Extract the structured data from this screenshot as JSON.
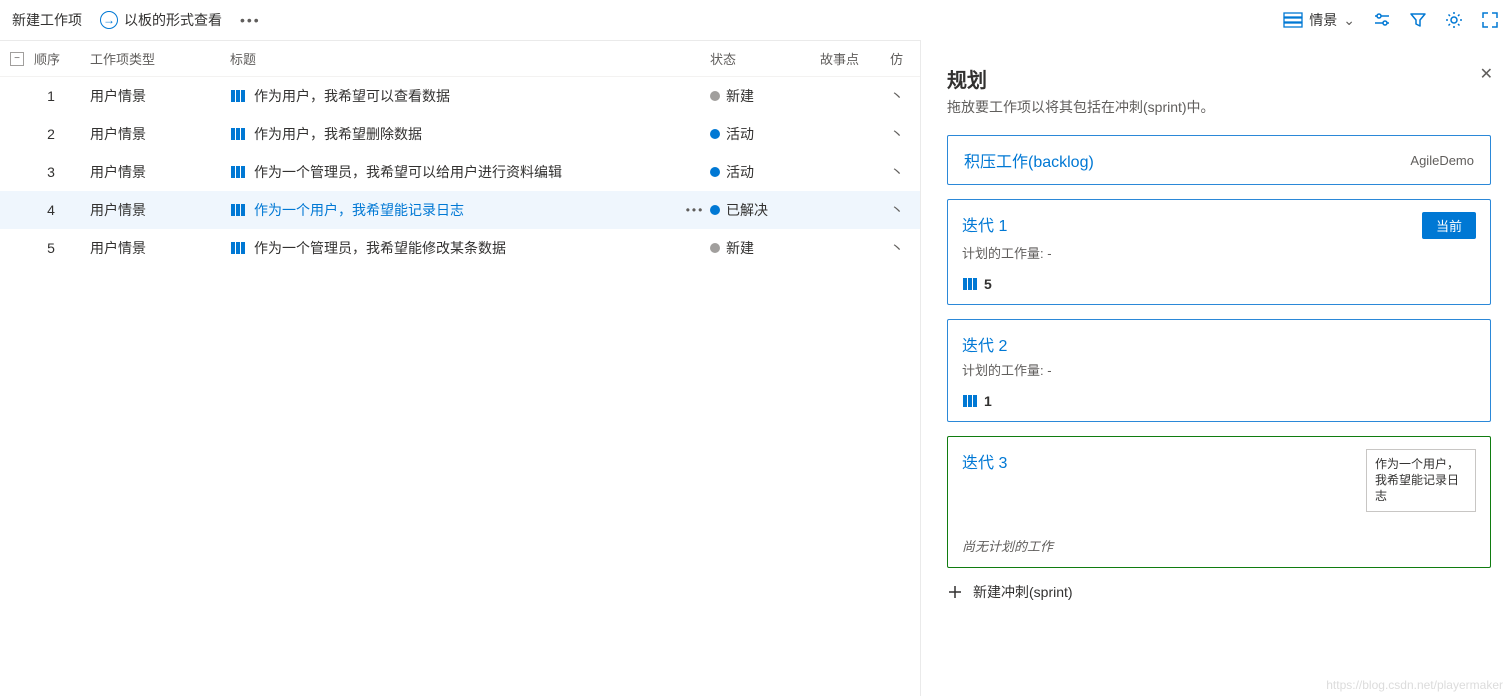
{
  "toolbar": {
    "new_workitem": "新建工作项",
    "view_as_board": "以板的形式查看",
    "level_label": "情景"
  },
  "grid": {
    "headers": {
      "order": "顺序",
      "type": "工作项类型",
      "title": "标题",
      "state": "状态",
      "story_points": "故事点",
      "extra": "仿"
    },
    "rows": [
      {
        "order": "1",
        "type": "用户情景",
        "title": "作为用户，我希望可以查看数据",
        "state": "新建",
        "state_color": "#a19f9d",
        "selected": false
      },
      {
        "order": "2",
        "type": "用户情景",
        "title": "作为用户，我希望删除数据",
        "state": "活动",
        "state_color": "#0078d4",
        "selected": false
      },
      {
        "order": "3",
        "type": "用户情景",
        "title": "作为一个管理员，我希望可以给用户进行资料编辑",
        "state": "活动",
        "state_color": "#0078d4",
        "selected": false
      },
      {
        "order": "4",
        "type": "用户情景",
        "title": "作为一个用户，我希望能记录日志",
        "state": "已解决",
        "state_color": "#0078d4",
        "selected": true
      },
      {
        "order": "5",
        "type": "用户情景",
        "title": "作为一个管理员，我希望能修改某条数据",
        "state": "新建",
        "state_color": "#a19f9d",
        "selected": false
      }
    ]
  },
  "panel": {
    "title": "规划",
    "subtitle": "拖放要工作项以将其包括在冲刺(sprint)中。",
    "backlog": {
      "title": "积压工作(backlog)",
      "team": "AgileDemo"
    },
    "sprints": [
      {
        "title": "迭代 1",
        "subtitle": "计划的工作量: -",
        "badge": "当前",
        "count": "5",
        "green": false,
        "empty": false
      },
      {
        "title": "迭代 2",
        "subtitle": "计划的工作量: -",
        "badge": "",
        "count": "1",
        "green": false,
        "empty": false
      },
      {
        "title": "迭代 3",
        "subtitle": "尚无计划的工作",
        "badge": "",
        "count": "",
        "green": true,
        "empty": true,
        "drag_card": "作为一个用户，我希望能记录日志"
      }
    ],
    "new_sprint": "新建冲刺(sprint)"
  },
  "watermark": "https://blog.csdn.net/playermaker"
}
